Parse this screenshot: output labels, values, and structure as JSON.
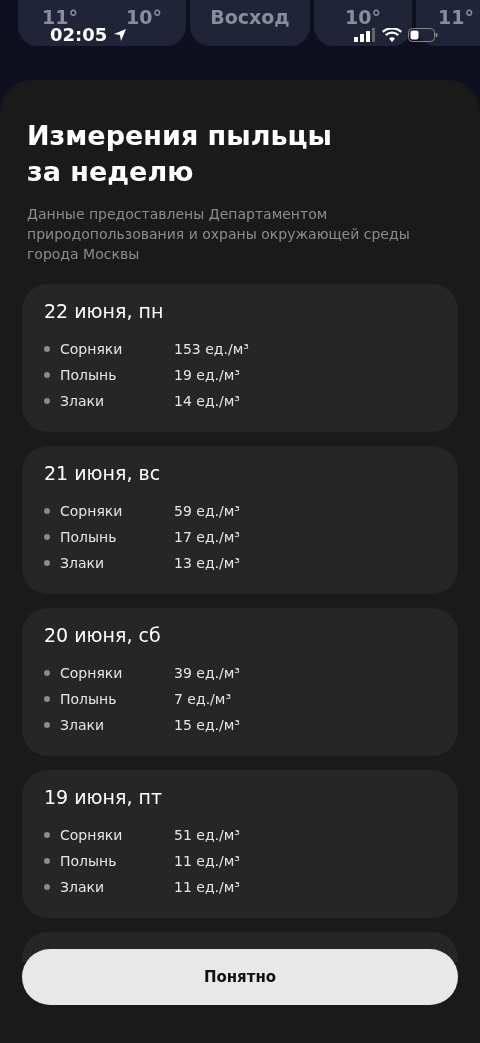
{
  "status_bar": {
    "time": "02:05"
  },
  "weather_strip": [
    {
      "texts": [
        "11°",
        "10°"
      ]
    },
    {
      "texts": [
        "Восход"
      ]
    },
    {
      "texts": [
        "10°"
      ]
    },
    {
      "texts": [
        "11°"
      ]
    }
  ],
  "sheet": {
    "title": "Измерения пыльцы за неделю",
    "subtitle": "Данные предоставлены Департаментом природопользования и охраны окружающей среды города Москвы",
    "days": [
      {
        "date": "22 июня, пн",
        "rows": [
          {
            "name": "Сорняки",
            "value": "153 ед./м³"
          },
          {
            "name": "Полынь",
            "value": "19 ед./м³"
          },
          {
            "name": "Злаки",
            "value": "14 ед./м³"
          }
        ]
      },
      {
        "date": "21 июня, вс",
        "rows": [
          {
            "name": "Сорняки",
            "value": "59 ед./м³"
          },
          {
            "name": "Полынь",
            "value": "17 ед./м³"
          },
          {
            "name": "Злаки",
            "value": "13 ед./м³"
          }
        ]
      },
      {
        "date": "20 июня, сб",
        "rows": [
          {
            "name": "Сорняки",
            "value": "39 ед./м³"
          },
          {
            "name": "Полынь",
            "value": "7 ед./м³"
          },
          {
            "name": "Злаки",
            "value": "15 ед./м³"
          }
        ]
      },
      {
        "date": "19 июня, пт",
        "rows": [
          {
            "name": "Сорняки",
            "value": "51 ед./м³"
          },
          {
            "name": "Полынь",
            "value": "11 ед./м³"
          },
          {
            "name": "Злаки",
            "value": "11 ед./м³"
          }
        ]
      }
    ],
    "button": "Понятно"
  }
}
